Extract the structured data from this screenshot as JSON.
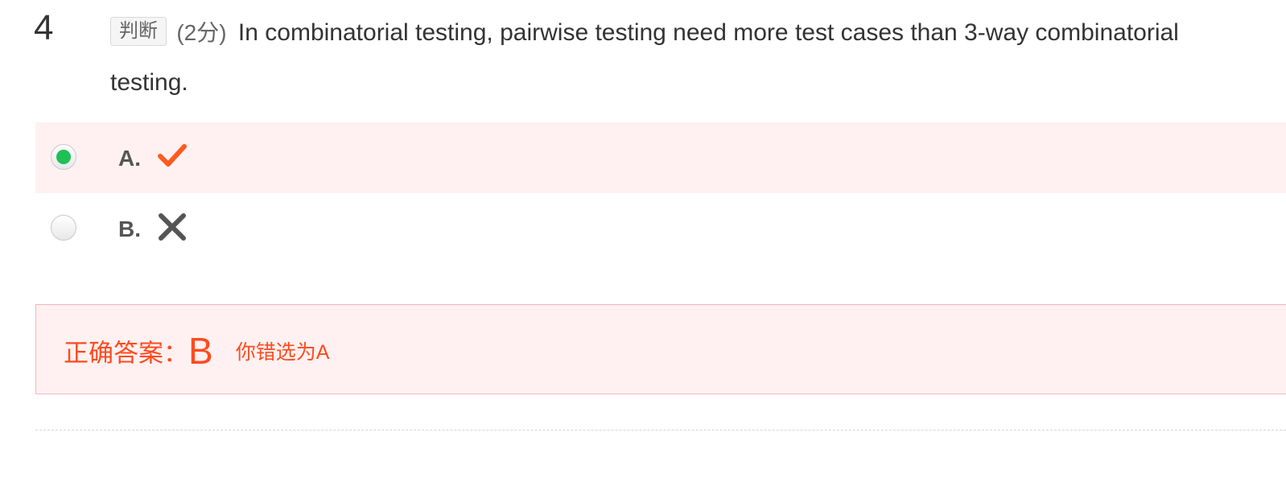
{
  "question": {
    "number": "4",
    "type": "判断",
    "score": "(2分)",
    "text": "In combinatorial testing, pairwise testing need more test cases than 3-way combinatorial testing."
  },
  "options": [
    {
      "letter": "A.",
      "icon": "check-icon",
      "icon_color": "#ff5a1f",
      "selected": true
    },
    {
      "letter": "B.",
      "icon": "cross-icon",
      "icon_color": "#555555",
      "selected": false
    }
  ],
  "answer": {
    "label": "正确答案：",
    "value": "B",
    "wrong_note": "你错选为A"
  },
  "colors": {
    "accent_red": "#ff4b1f",
    "selected_green": "#1ec057",
    "panel_pink": "#fff1f1"
  }
}
